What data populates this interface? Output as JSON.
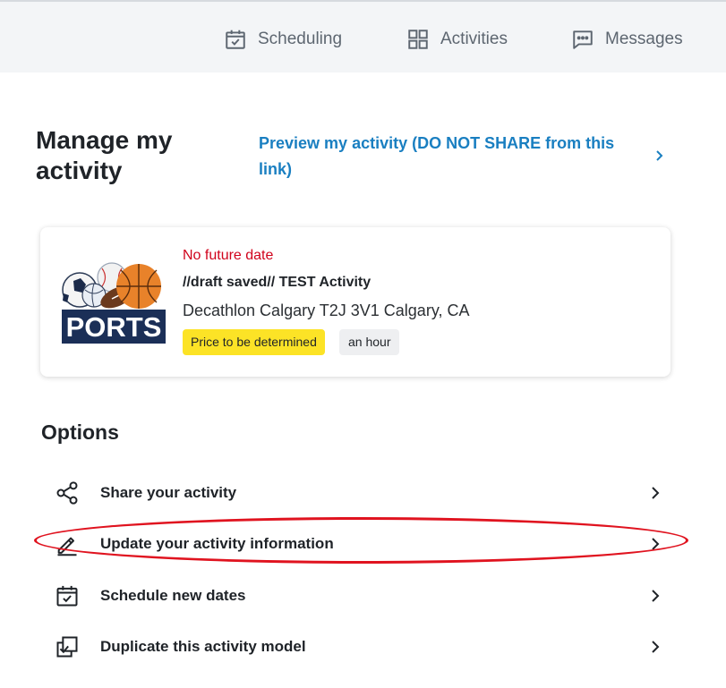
{
  "nav": {
    "scheduling": "Scheduling",
    "activities": "Activities",
    "messages": "Messages"
  },
  "header": {
    "title": "Manage my activity",
    "preview_link": "Preview my activity (DO NOT SHARE from this link)"
  },
  "card": {
    "date_status": "No future date",
    "name": "//draft saved// TEST Activity",
    "location": "Decathlon Calgary T2J 3V1 Calgary, CA",
    "price_badge": "Price to be determined",
    "duration_badge": "an hour",
    "thumbnail_text": "PORTS"
  },
  "options": {
    "title": "Options",
    "items": [
      {
        "label": "Share your activity",
        "icon": "share-icon"
      },
      {
        "label": "Update your activity information",
        "icon": "pencil-icon"
      },
      {
        "label": "Schedule new dates",
        "icon": "calendar-check-icon"
      },
      {
        "label": "Duplicate this activity model",
        "icon": "duplicate-icon"
      }
    ]
  },
  "colors": {
    "link": "#1a7fc1",
    "date_warning": "#d0021b",
    "price_badge_bg": "#fce326",
    "highlight": "#e0131f",
    "nav_bg": "#f3f5f7"
  }
}
